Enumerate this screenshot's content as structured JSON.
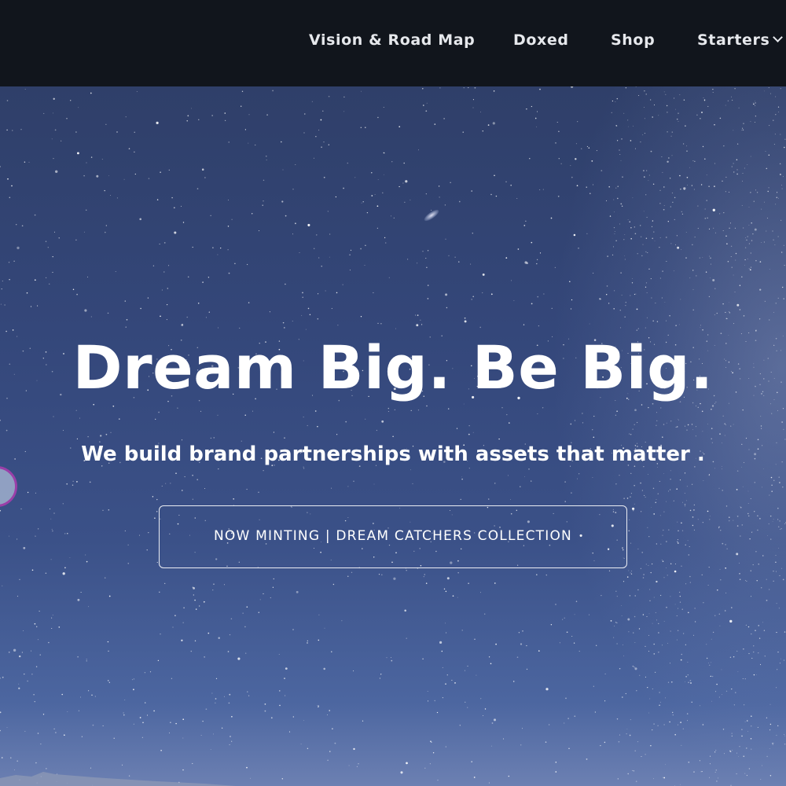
{
  "nav": {
    "items": [
      {
        "label": "Vision & Road Map"
      },
      {
        "label": "Doxed"
      },
      {
        "label": "Shop"
      },
      {
        "label": "Starters",
        "icon": "chevron-down-icon"
      }
    ]
  },
  "hero": {
    "title": "Dream Big. Be Big.",
    "subtitle": "We build brand partnerships with assets that matter .",
    "cta_label": "NOW MINTING | DREAM CATCHERS COLLECTION"
  },
  "colors": {
    "nav_background": "#11151c",
    "sky_top": "#2f3f69",
    "sky_bottom": "#6c80b2",
    "text": "#ffffff",
    "handle_border": "#9a3fa8"
  }
}
